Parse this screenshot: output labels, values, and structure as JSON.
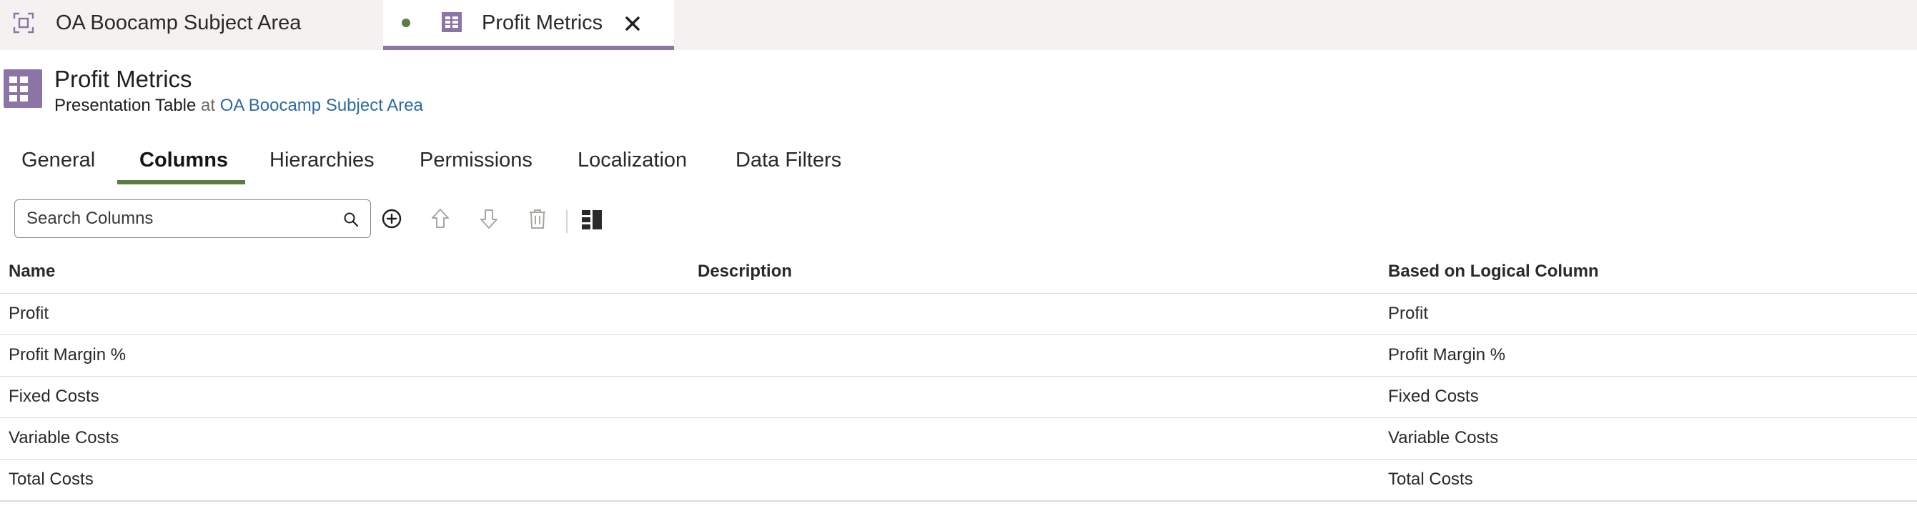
{
  "tabs": {
    "subject_area_tab": "OA Boocamp Subject Area",
    "profit_tab": "Profit Metrics"
  },
  "header": {
    "title": "Profit Metrics",
    "subtitle_type": "Presentation Table",
    "subtitle_at": "at",
    "subtitle_link": "OA Boocamp Subject Area"
  },
  "section_tabs": [
    {
      "label": "General"
    },
    {
      "label": "Columns",
      "active": true
    },
    {
      "label": "Hierarchies"
    },
    {
      "label": "Permissions"
    },
    {
      "label": "Localization"
    },
    {
      "label": "Data Filters"
    }
  ],
  "toolbar": {
    "search_placeholder": "Search Columns",
    "icons": [
      "add-icon",
      "move-up-icon",
      "move-down-icon",
      "delete-icon",
      "column-layout-icon"
    ]
  },
  "table": {
    "headers": [
      "Name",
      "Description",
      "Based on Logical Column"
    ],
    "rows": [
      [
        "Profit",
        "",
        "Profit"
      ],
      [
        "Profit Margin %",
        "",
        "Profit Margin %"
      ],
      [
        "Fixed Costs",
        "",
        "Fixed Costs"
      ],
      [
        "Variable Costs",
        "",
        "Variable Costs"
      ],
      [
        "Total Costs",
        "",
        "Total Costs"
      ]
    ]
  },
  "colors": {
    "accent_purple": "#8c74a6",
    "accent_green": "#5a7b43",
    "link_blue": "#2b6aa5",
    "tabstrip_bg": "#f3f2f1"
  }
}
